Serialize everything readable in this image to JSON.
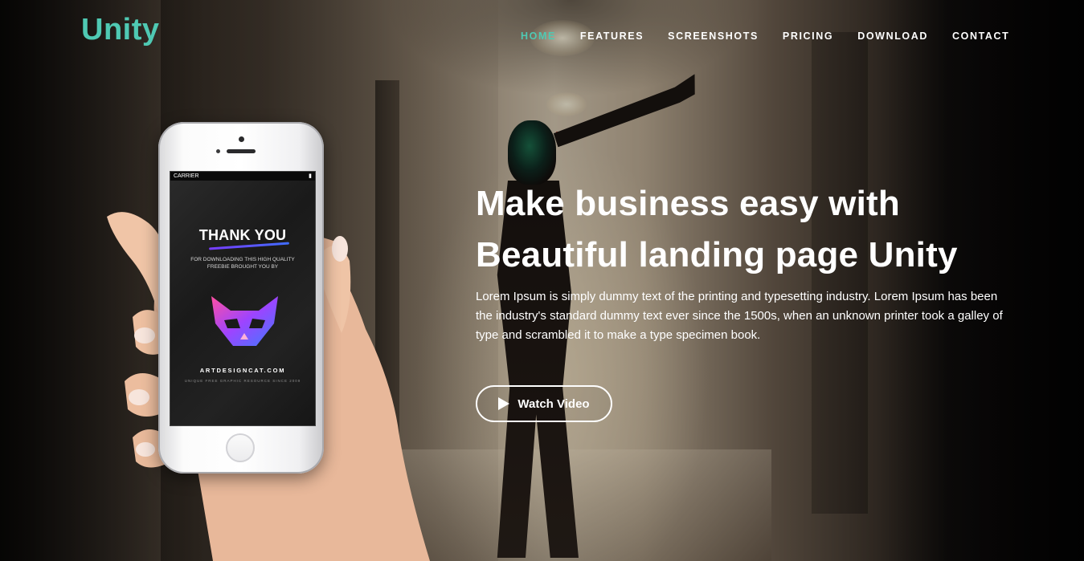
{
  "brand": {
    "logo": "Unity",
    "accent": "#4fc9b3"
  },
  "nav": {
    "items": [
      {
        "label": "HOME",
        "active": true
      },
      {
        "label": "FEATURES",
        "active": false
      },
      {
        "label": "SCREENSHOTS",
        "active": false
      },
      {
        "label": "PRICING",
        "active": false
      },
      {
        "label": "DOWNLOAD",
        "active": false
      },
      {
        "label": "CONTACT",
        "active": false
      }
    ]
  },
  "hero": {
    "headline_line1": "Make business easy with",
    "headline_line2": "Beautiful landing page Unity",
    "lead": "Lorem Ipsum is simply dummy text of the printing and typesetting industry. Lorem Ipsum has been the industry's standard dummy text ever since the 1500s, when an unknown printer took a galley of type and scrambled it to make a type specimen book.",
    "cta_label": "Watch Video",
    "cta_icon": "play-icon"
  },
  "phone_screen": {
    "carrier": "CARRIER",
    "title": "THANK YOU",
    "subtitle": "FOR DOWNLOADING THIS HIGH QUALITY FREEBIE BROUGHT YOU BY",
    "site": "ARTDESIGNCAT.COM",
    "tagline": "UNIQUE FREE GRAPHIC RESOURCE SINCE 2009"
  }
}
